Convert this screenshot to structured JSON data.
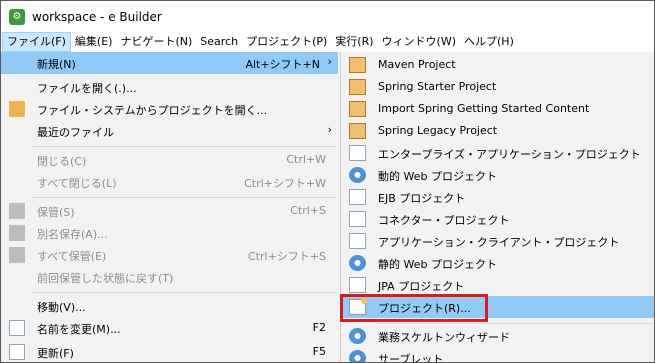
{
  "window": {
    "title": "workspace - e Builder"
  },
  "menubar": {
    "items": [
      "ファイル(F)",
      "編集(E)",
      "ナビゲート(N)",
      "Search",
      "プロジェクト(P)",
      "実行(R)",
      "ウィンドウ(W)",
      "ヘルプ(H)"
    ]
  },
  "file_menu": {
    "new": {
      "label": "新規(N)",
      "acc": "Alt+シフト+N"
    },
    "open_file": {
      "label": "ファイルを開く(.)..."
    },
    "open_project": {
      "label": "ファイル・システムからプロジェクトを開く..."
    },
    "recent": {
      "label": "最近のファイル"
    },
    "close": {
      "label": "閉じる(C)",
      "acc": "Ctrl+W"
    },
    "close_all": {
      "label": "すべて閉じる(L)",
      "acc": "Ctrl+シフト+W"
    },
    "save": {
      "label": "保管(S)",
      "acc": "Ctrl+S"
    },
    "save_as": {
      "label": "別名保存(A)..."
    },
    "save_all": {
      "label": "すべて保管(E)",
      "acc": "Ctrl+シフト+S"
    },
    "revert": {
      "label": "前回保管した状態に戻す(T)"
    },
    "move": {
      "label": "移動(V)..."
    },
    "rename": {
      "label": "名前を変更(M)...",
      "acc": "F2"
    },
    "refresh": {
      "label": "更新(F)",
      "acc": "F5"
    }
  },
  "sub_menu": {
    "items": [
      {
        "label": "Maven Project",
        "icon": "maven-project-icon"
      },
      {
        "label": "Spring Starter Project",
        "icon": "spring-starter-icon"
      },
      {
        "label": "Import Spring Getting Started Content",
        "icon": "spring-import-icon"
      },
      {
        "label": "Spring Legacy Project",
        "icon": "spring-legacy-icon"
      },
      {
        "label": "エンタープライズ・アプリケーション・プロジェクト",
        "icon": "enterprise-app-icon"
      },
      {
        "label": "動的 Web プロジェクト",
        "icon": "dynamic-web-icon"
      },
      {
        "label": "EJB プロジェクト",
        "icon": "ejb-project-icon"
      },
      {
        "label": "コネクター・プロジェクト",
        "icon": "connector-project-icon"
      },
      {
        "label": "アプリケーション・クライアント・プロジェクト",
        "icon": "app-client-icon"
      },
      {
        "label": "静的 Web プロジェクト",
        "icon": "static-web-icon"
      },
      {
        "label": "JPA プロジェクト",
        "icon": "jpa-project-icon"
      },
      {
        "label": "プロジェクト(R)...",
        "icon": "project-icon"
      },
      {
        "label": "業務スケルトンウィザード",
        "icon": "skeleton-wizard-icon"
      },
      {
        "label": "サーブレット",
        "icon": "servlet-icon"
      }
    ]
  },
  "colors": {
    "highlight": "#91c9f7",
    "annotation": "#d71e1e",
    "menu_bg": "#f2f2f2"
  }
}
